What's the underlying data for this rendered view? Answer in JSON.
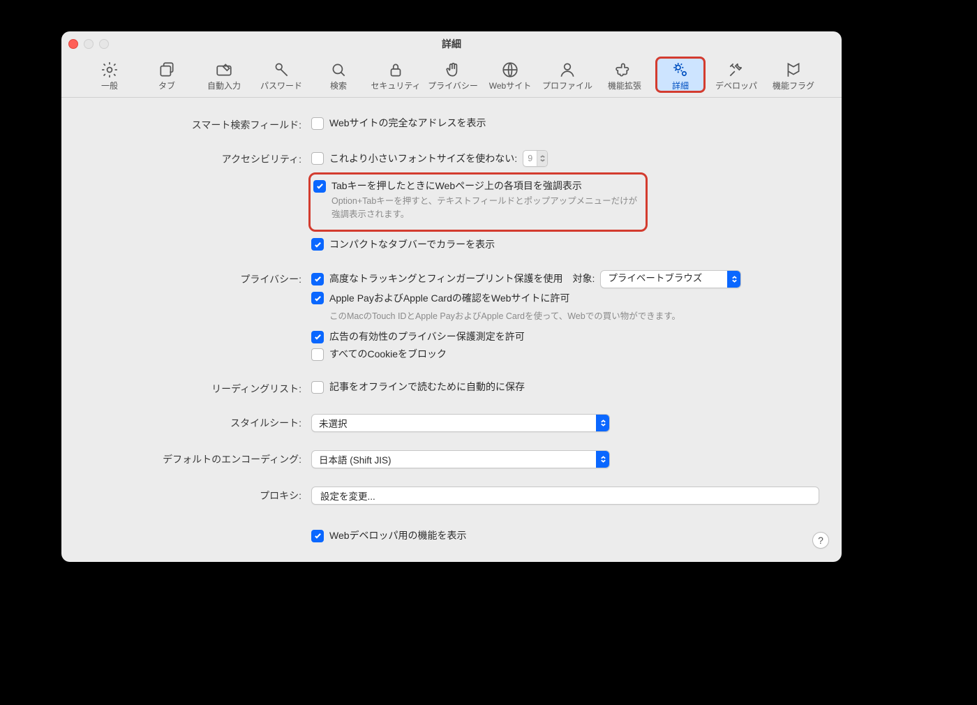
{
  "window": {
    "title": "詳細"
  },
  "toolbar": {
    "tabs": [
      {
        "id": "general",
        "label": "一般"
      },
      {
        "id": "tabs",
        "label": "タブ"
      },
      {
        "id": "autofill",
        "label": "自動入力"
      },
      {
        "id": "passwords",
        "label": "パスワード"
      },
      {
        "id": "search",
        "label": "検索"
      },
      {
        "id": "security",
        "label": "セキュリティ"
      },
      {
        "id": "privacy",
        "label": "プライバシー"
      },
      {
        "id": "websites",
        "label": "Webサイト"
      },
      {
        "id": "profiles",
        "label": "プロファイル"
      },
      {
        "id": "extensions",
        "label": "機能拡張"
      },
      {
        "id": "advanced",
        "label": "詳細"
      },
      {
        "id": "developer",
        "label": "デベロッパ"
      },
      {
        "id": "featureflags",
        "label": "機能フラグ"
      }
    ],
    "active_tab_id": "advanced"
  },
  "sections": {
    "smart_search": {
      "label": "スマート検索フィールド:",
      "show_full_address": {
        "label": "Webサイトの完全なアドレスを表示",
        "checked": false
      }
    },
    "accessibility": {
      "label": "アクセシビリティ:",
      "min_font": {
        "label": "これより小さいフォントサイズを使わない:",
        "checked": false,
        "value": "9"
      },
      "tab_highlight": {
        "label": "Tabキーを押したときにWebページ上の各項目を強調表示",
        "checked": true,
        "note": "Option+Tabキーを押すと、テキストフィールドとポップアップメニューだけが強調表示されます。"
      },
      "compact_color": {
        "label": "コンパクトなタブバーでカラーを表示",
        "checked": true
      }
    },
    "privacy": {
      "label": "プライバシー:",
      "tracking": {
        "label": "高度なトラッキングとフィンガープリント保護を使用　対象:",
        "checked": true,
        "scope_value": "プライベートブラウズ"
      },
      "apple_pay": {
        "label": "Apple PayおよびApple Cardの確認をWebサイトに許可",
        "checked": true,
        "note": "このMacのTouch IDとApple PayおよびApple Cardを使って、Webでの買い物ができます。"
      },
      "ad_measure": {
        "label": "広告の有効性のプライバシー保護測定を許可",
        "checked": true
      },
      "block_cookie": {
        "label": "すべてのCookieをブロック",
        "checked": false
      }
    },
    "reading_list": {
      "label": "リーディングリスト:",
      "save_offline": {
        "label": "記事をオフラインで読むために自動的に保存",
        "checked": false
      }
    },
    "stylesheet": {
      "label": "スタイルシート:",
      "value": "未選択"
    },
    "encoding": {
      "label": "デフォルトのエンコーディング:",
      "value": "日本語 (Shift JIS)"
    },
    "proxy": {
      "label": "プロキシ:",
      "button": "設定を変更..."
    },
    "developer": {
      "show_features": {
        "label": "Webデベロッパ用の機能を表示",
        "checked": true
      }
    }
  },
  "help": {
    "label": "?"
  }
}
